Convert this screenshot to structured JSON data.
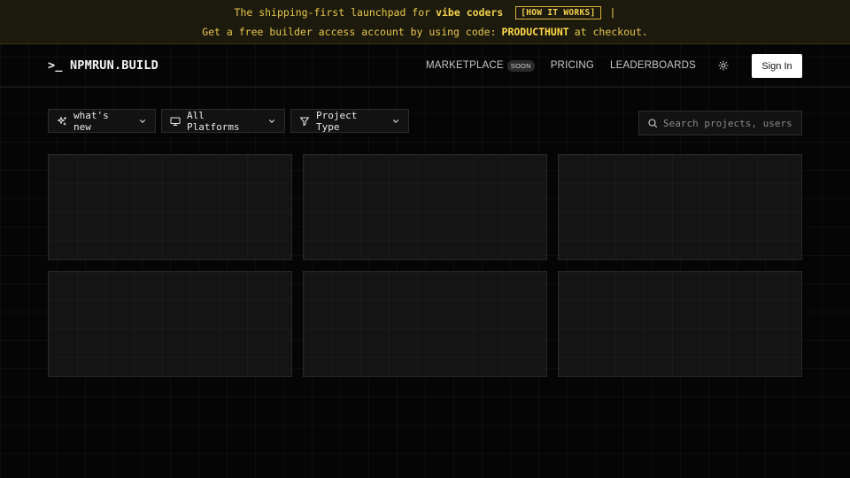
{
  "banner": {
    "line1_prefix": "The shipping-first launchpad for",
    "line1_highlight": "vibe coders",
    "how_it_works": "[HOW IT WORKS]",
    "pipe": "|",
    "line2_prefix": "Get a free builder access account by using code:",
    "code": "PRODUCTHUNT",
    "line2_suffix": "at checkout."
  },
  "header": {
    "logo": ">_ NPMRUN.BUILD",
    "nav": {
      "marketplace": "MARKETPLACE",
      "soon_badge": "SOON",
      "pricing": "PRICING",
      "leaderboards": "LEADERBOARDS"
    },
    "theme_icon": "sun-icon",
    "sign_in": "Sign In"
  },
  "filters": {
    "sort": {
      "label": "what's new",
      "icon": "sparkles-icon"
    },
    "platform": {
      "label": "All Platforms",
      "icon": "monitor-icon"
    },
    "project_type": {
      "label": "Project Type",
      "icon": "filter-icon"
    }
  },
  "search": {
    "placeholder": "Search projects, users...",
    "value": ""
  },
  "colors": {
    "background": "#050505",
    "banner_bg": "#1c1a0c",
    "banner_text": "#e7c64a",
    "card_bg": "#181818"
  }
}
